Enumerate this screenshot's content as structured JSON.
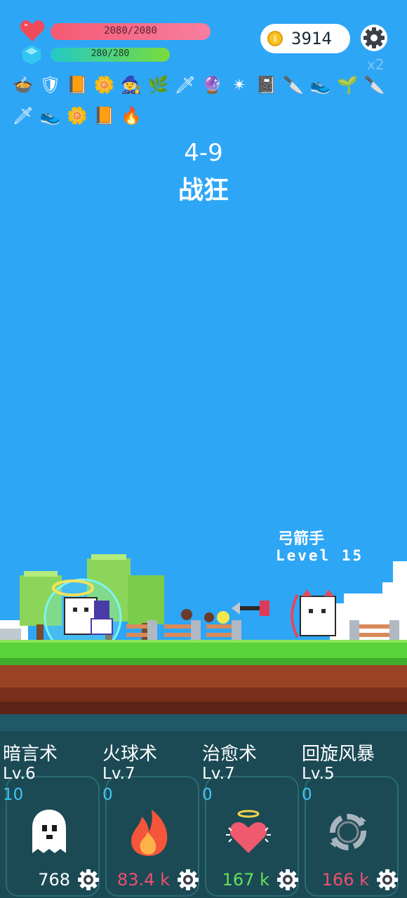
{
  "hud": {
    "hp_text": "2080/2080",
    "hp_fraction": 1.0,
    "mp_text": "280/280",
    "mp_fraction": 1.0,
    "coins": "3914",
    "speed_label": "x2",
    "heart_icon": "heart-icon",
    "gem_icon": "mana-gem-icon",
    "settings_icon": "gear-icon"
  },
  "items": [
    {
      "name": "cauldron-icon",
      "glyph": "🍲"
    },
    {
      "name": "shield-icon",
      "glyph": "🛡"
    },
    {
      "name": "spellbook-icon",
      "glyph": "📙"
    },
    {
      "name": "flower-icon",
      "glyph": "🌼"
    },
    {
      "name": "wizard-hat-icon",
      "glyph": "🧙"
    },
    {
      "name": "herb-icon",
      "glyph": "🌿"
    },
    {
      "name": "sword-icon",
      "glyph": "🗡"
    },
    {
      "name": "crystal-ball-icon",
      "glyph": "🔮"
    },
    {
      "name": "spiked-ball-icon",
      "glyph": "✴"
    },
    {
      "name": "skull-book-icon",
      "glyph": "📓"
    },
    {
      "name": "dagger-icon",
      "glyph": "🔪"
    },
    {
      "name": "winged-boot-icon",
      "glyph": "👟"
    },
    {
      "name": "sapling-icon",
      "glyph": "🌱"
    },
    {
      "name": "short-dagger-icon",
      "glyph": "🔪"
    },
    {
      "name": "sword-icon-2",
      "glyph": "🗡"
    },
    {
      "name": "winged-boot-icon-2",
      "glyph": "👟"
    },
    {
      "name": "flower-icon-2",
      "glyph": "🌼"
    },
    {
      "name": "spellbook-icon-2",
      "glyph": "📙"
    },
    {
      "name": "torch-icon",
      "glyph": "🔥"
    }
  ],
  "stage": {
    "number": "4-9",
    "name": "战狂"
  },
  "enemy": {
    "name": "弓箭手",
    "level": "Level 15"
  },
  "skills": [
    {
      "name": "暗言术",
      "level": "Lv.6",
      "count": "10",
      "cost": "768",
      "cost_color": "#ffffff",
      "icon": "ghost-icon"
    },
    {
      "name": "火球术",
      "level": "Lv.7",
      "count": "0",
      "cost": "83.4 k",
      "cost_color": "#f0506e",
      "icon": "fireball-icon"
    },
    {
      "name": "治愈术",
      "level": "Lv.7",
      "count": "0",
      "cost": "167 k",
      "cost_color": "#66e05a",
      "icon": "holy-heart-icon"
    },
    {
      "name": "回旋风暴",
      "level": "Lv.5",
      "count": "0",
      "cost": "166 k",
      "cost_color": "#f0506e",
      "icon": "whirlwind-icon"
    }
  ]
}
